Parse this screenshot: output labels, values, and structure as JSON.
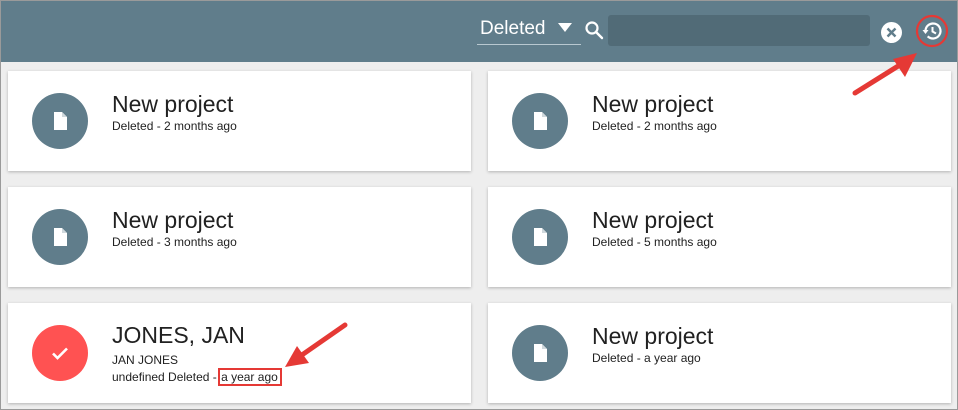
{
  "toolbar": {
    "filter_value": "Deleted",
    "search_value": "",
    "icons": {
      "filter_caret": "caret-down-icon",
      "search": "search-icon",
      "clear": "close-circle-icon",
      "history": "history-icon"
    }
  },
  "cards": [
    {
      "title": "New project",
      "subtitle": "Deleted - 2 months ago",
      "icon": "document-icon"
    },
    {
      "title": "New project",
      "subtitle": "Deleted - 2 months ago",
      "icon": "document-icon"
    },
    {
      "title": "New project",
      "subtitle": "Deleted - 3 months ago",
      "icon": "document-icon"
    },
    {
      "title": "New project",
      "subtitle": "Deleted - 5 months ago",
      "icon": "document-icon"
    },
    {
      "title": "JONES, JAN",
      "line1": "JAN JONES",
      "line2_prefix": "undefined Deleted - ",
      "line2_time": "a year ago",
      "icon": "checkmark-icon",
      "selected": true
    },
    {
      "title": "New project",
      "subtitle": "Deleted - a year ago",
      "icon": "document-icon"
    }
  ],
  "colors": {
    "toolbar": "#607d8b",
    "avatar": "#607d8b",
    "avatar_selected": "#ff5252",
    "annotation": "#e53935"
  }
}
